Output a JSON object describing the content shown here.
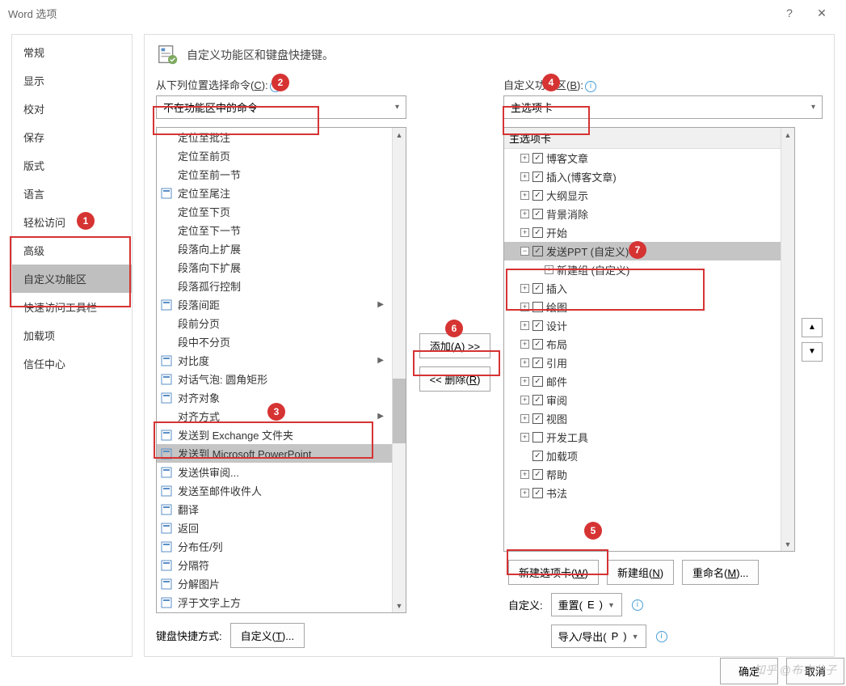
{
  "title": "Word 选项",
  "sidebar": {
    "items": [
      {
        "label": "常规"
      },
      {
        "label": "显示"
      },
      {
        "label": "校对"
      },
      {
        "label": "保存"
      },
      {
        "label": "版式"
      },
      {
        "label": "语言"
      },
      {
        "label": "轻松访问"
      },
      {
        "label": "高级"
      },
      {
        "label": "自定义功能区"
      },
      {
        "label": "快速访问工具栏"
      },
      {
        "label": "加载项"
      },
      {
        "label": "信任中心"
      }
    ],
    "selected_index": 8
  },
  "header": "自定义功能区和键盘快捷键。",
  "left_col": {
    "label_pre": "从下列位置选择命令(",
    "label_u": "C",
    "label_post": "):",
    "dropdown": "不在功能区中的命令",
    "commands": [
      {
        "text": "定位至批注",
        "icon": ""
      },
      {
        "text": "定位至前页",
        "icon": ""
      },
      {
        "text": "定位至前一节",
        "icon": ""
      },
      {
        "text": "定位至尾注",
        "icon": "endnote"
      },
      {
        "text": "定位至下页",
        "icon": ""
      },
      {
        "text": "定位至下一节",
        "icon": ""
      },
      {
        "text": "段落向上扩展",
        "icon": ""
      },
      {
        "text": "段落向下扩展",
        "icon": ""
      },
      {
        "text": "段落孤行控制",
        "icon": ""
      },
      {
        "text": "段落间距",
        "icon": "spacing",
        "sub": "▶"
      },
      {
        "text": "段前分页",
        "icon": ""
      },
      {
        "text": "段中不分页",
        "icon": ""
      },
      {
        "text": "对比度",
        "icon": "contrast",
        "sub": "▶"
      },
      {
        "text": "对话气泡: 圆角矩形",
        "icon": "callout"
      },
      {
        "text": "对齐对象",
        "icon": "align"
      },
      {
        "text": "对齐方式",
        "icon": "",
        "sub": "▶"
      },
      {
        "text": "发送到 Exchange 文件夹",
        "icon": "send"
      },
      {
        "text": "发送到 Microsoft PowerPoint",
        "icon": "ppt",
        "selected": true
      },
      {
        "text": "发送供审阅...",
        "icon": "review"
      },
      {
        "text": "发送至邮件收件人",
        "icon": "mail"
      },
      {
        "text": "翻译",
        "icon": "translate"
      },
      {
        "text": "返回",
        "icon": "back"
      },
      {
        "text": "分布任/列",
        "icon": "dist"
      },
      {
        "text": "分隔符",
        "icon": "sep"
      },
      {
        "text": "分解图片",
        "icon": "decomp"
      },
      {
        "text": "浮于文字上方",
        "icon": "float"
      }
    ],
    "kbd_label": "键盘快捷方式:",
    "kbd_btn_pre": "自定义(",
    "kbd_btn_u": "T",
    "kbd_btn_post": ")..."
  },
  "mid": {
    "add_pre": "添加(",
    "add_u": "A",
    "add_post": ") >>",
    "rem_pre": "<< 删除(",
    "rem_u": "R",
    "rem_post": ")"
  },
  "right_col": {
    "label_pre": "自定义功能区(",
    "label_u": "B",
    "label_post": "):",
    "dropdown": "主选项卡",
    "tree_header": "主选项卡",
    "items": [
      {
        "label": "博客文章",
        "checked": true
      },
      {
        "label": "插入(博客文章)",
        "checked": true
      },
      {
        "label": "大纲显示",
        "checked": true
      },
      {
        "label": "背景消除",
        "checked": true
      },
      {
        "label": "开始",
        "checked": true
      },
      {
        "label": "发送PPT (自定义)",
        "checked": true,
        "expanded": true,
        "selected": true,
        "child": "新建组 (自定义)"
      },
      {
        "label": "插入",
        "checked": true
      },
      {
        "label": "绘图",
        "checked": false
      },
      {
        "label": "设计",
        "checked": true
      },
      {
        "label": "布局",
        "checked": true
      },
      {
        "label": "引用",
        "checked": true
      },
      {
        "label": "邮件",
        "checked": true
      },
      {
        "label": "审阅",
        "checked": true
      },
      {
        "label": "视图",
        "checked": true
      },
      {
        "label": "开发工具",
        "checked": false
      },
      {
        "label": "加载项",
        "checked": true,
        "noexp": true
      },
      {
        "label": "帮助",
        "checked": true
      },
      {
        "label": "书法",
        "checked": true
      }
    ],
    "newtab_pre": "新建选项卡(",
    "newtab_u": "W",
    "newtab_post": ")",
    "newgrp_pre": "新建组(",
    "newgrp_u": "N",
    "newgrp_post": ")",
    "rename_pre": "重命名(",
    "rename_u": "M",
    "rename_post": ")...",
    "custom_label": "自定义:",
    "reset_pre": "重置(",
    "reset_u": "E",
    "reset_post": ")",
    "impexp_pre": "导入/导出(",
    "impexp_u": "P",
    "impexp_post": ")"
  },
  "footer": {
    "ok": "确定",
    "cancel": "取消"
  },
  "watermark": "知乎 @布衣公子",
  "badges": {
    "1": "1",
    "2": "2",
    "3": "3",
    "4": "4",
    "5": "5",
    "6": "6",
    "7": "7"
  }
}
